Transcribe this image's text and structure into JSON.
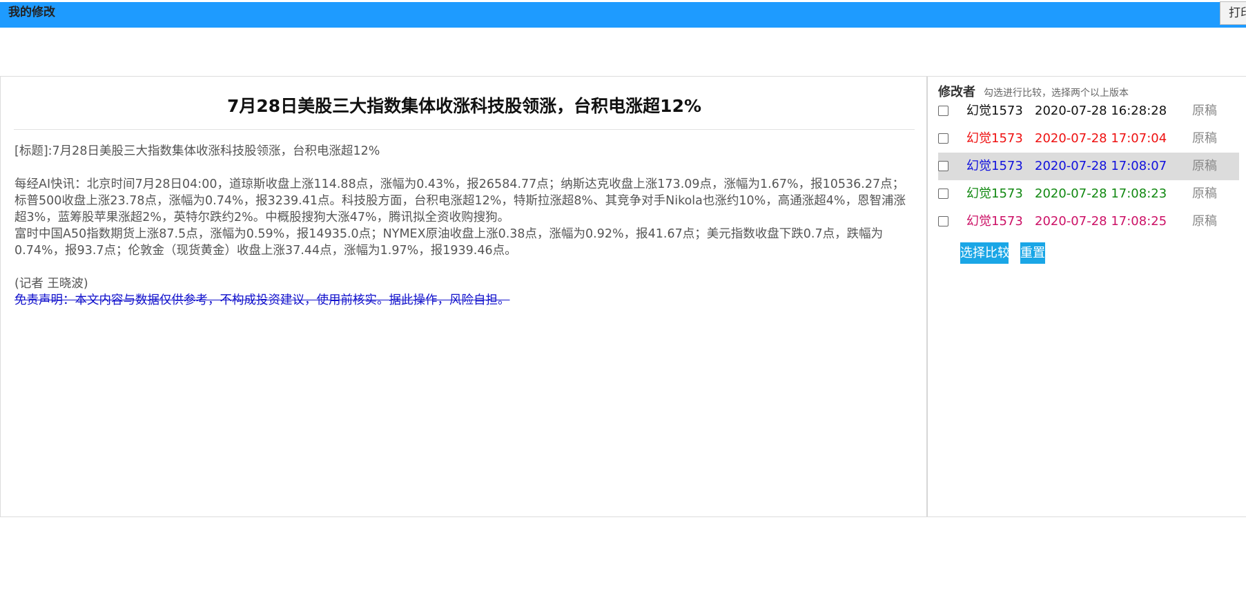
{
  "header": {
    "title": "我的修改",
    "print_label": "打印",
    "bg_color": "#1e9bff"
  },
  "article": {
    "title": "7月28日美股三大指数集体收涨科技股领涨，台积电涨超12%",
    "label_line": "[标题]:7月28日美股三大指数集体收涨科技股领涨，台积电涨超12%",
    "paragraph1": "每经AI快讯：北京时间7月28日04:00，道琼斯收盘上涨114.88点，涨幅为0.43%，报26584.77点；纳斯达克收盘上涨173.09点，涨幅为1.67%，报10536.27点；标普500收盘上涨23.78点，涨幅为0.74%，报3239.41点。科技股方面，台积电涨超12%，特斯拉涨超8%、其竞争对手Nikola也涨约10%，高通涨超4%，恩智浦涨超3%，蓝筹股苹果涨超2%，英特尔跌约2%。中概股搜狗大涨47%，腾讯拟全资收购搜狗。",
    "paragraph2": "富时中国A50指数期货上涨87.5点，涨幅为0.59%，报14935.0点；NYMEX原油收盘上涨0.38点，涨幅为0.92%，报41.67点；美元指数收盘下跌0.7点，跌幅为0.74%，报93.7点；伦敦金（现货黄金）收盘上涨37.44点，涨幅为1.97%，报1939.46点。",
    "reporter": "(记者 王晓波)",
    "disclaimer": "免责声明：本文内容与数据仅供参考，不构成投资建议，使用前核实。据此操作，风险自担。"
  },
  "sidebar": {
    "label": "修改者",
    "hint": "勾选进行比较，选择两个以上版本",
    "revisions": [
      {
        "author": "幻觉1573",
        "time": "2020-07-28 16:28:28",
        "action": "原稿",
        "color": "#111111",
        "highlighted": false
      },
      {
        "author": "幻觉1573",
        "time": "2020-07-28 17:07:04",
        "action": "原稿",
        "color": "#ee1111",
        "highlighted": false
      },
      {
        "author": "幻觉1573",
        "time": "2020-07-28 17:08:07",
        "action": "原稿",
        "color": "#1111dd",
        "highlighted": true
      },
      {
        "author": "幻觉1573",
        "time": "2020-07-28 17:08:23",
        "action": "原稿",
        "color": "#118811",
        "highlighted": false
      },
      {
        "author": "幻觉1573",
        "time": "2020-07-28 17:08:25",
        "action": "原稿",
        "color": "#cc1166",
        "highlighted": false
      }
    ],
    "compare_label": "选择比较",
    "reset_label": "重置"
  }
}
